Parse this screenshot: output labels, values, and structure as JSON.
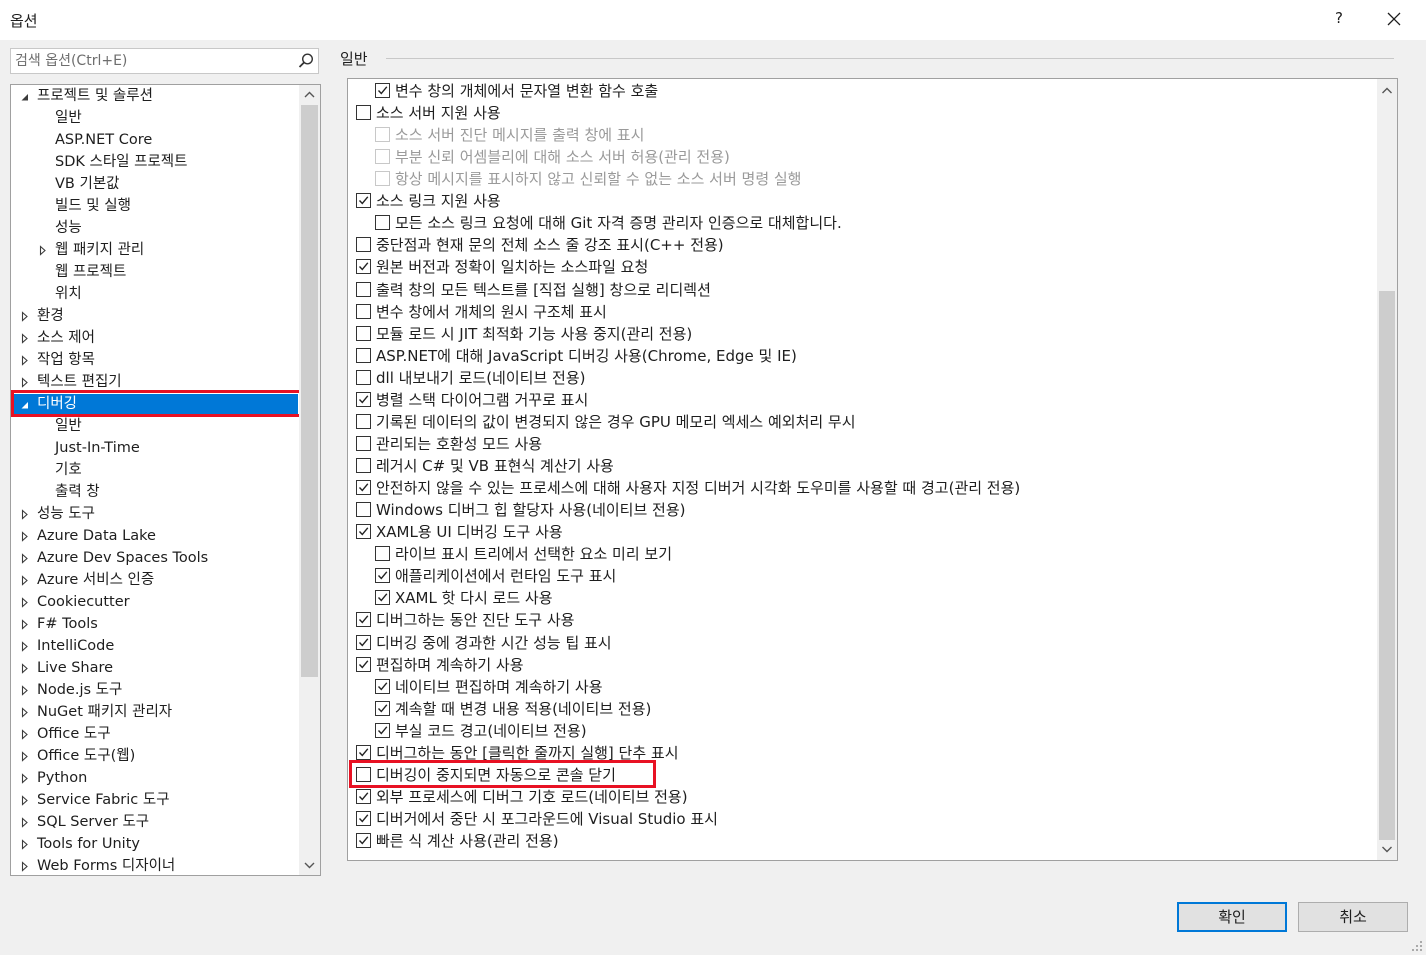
{
  "window": {
    "title": "옵션",
    "help_label": "?"
  },
  "search": {
    "placeholder": "검색 옵션(Ctrl+E)"
  },
  "tree": {
    "items": [
      {
        "label": "프로젝트 및 솔루션",
        "level": 0,
        "expander": "expanded"
      },
      {
        "label": "일반",
        "level": 1,
        "expander": "none"
      },
      {
        "label": "ASP.NET Core",
        "level": 1,
        "expander": "none"
      },
      {
        "label": "SDK 스타일 프로젝트",
        "level": 1,
        "expander": "none"
      },
      {
        "label": "VB 기본값",
        "level": 1,
        "expander": "none"
      },
      {
        "label": "빌드 및 실행",
        "level": 1,
        "expander": "none"
      },
      {
        "label": "성능",
        "level": 1,
        "expander": "none"
      },
      {
        "label": "웹 패키지 관리",
        "level": 1,
        "expander": "collapsed"
      },
      {
        "label": "웹 프로젝트",
        "level": 1,
        "expander": "none"
      },
      {
        "label": "위치",
        "level": 1,
        "expander": "none"
      },
      {
        "label": "환경",
        "level": 0,
        "expander": "collapsed"
      },
      {
        "label": "소스 제어",
        "level": 0,
        "expander": "collapsed"
      },
      {
        "label": "작업 항목",
        "level": 0,
        "expander": "collapsed"
      },
      {
        "label": "텍스트 편집기",
        "level": 0,
        "expander": "collapsed"
      },
      {
        "label": "디버깅",
        "level": 0,
        "expander": "expanded",
        "selected": true,
        "highlighted": true
      },
      {
        "label": "일반",
        "level": 1,
        "expander": "none"
      },
      {
        "label": "Just-In-Time",
        "level": 1,
        "expander": "none"
      },
      {
        "label": "기호",
        "level": 1,
        "expander": "none"
      },
      {
        "label": "출력 창",
        "level": 1,
        "expander": "none"
      },
      {
        "label": "성능 도구",
        "level": 0,
        "expander": "collapsed"
      },
      {
        "label": "Azure Data Lake",
        "level": 0,
        "expander": "collapsed"
      },
      {
        "label": "Azure Dev Spaces Tools",
        "level": 0,
        "expander": "collapsed"
      },
      {
        "label": "Azure 서비스 인증",
        "level": 0,
        "expander": "collapsed"
      },
      {
        "label": "Cookiecutter",
        "level": 0,
        "expander": "collapsed"
      },
      {
        "label": "F# Tools",
        "level": 0,
        "expander": "collapsed"
      },
      {
        "label": "IntelliCode",
        "level": 0,
        "expander": "collapsed"
      },
      {
        "label": "Live Share",
        "level": 0,
        "expander": "collapsed"
      },
      {
        "label": "Node.js 도구",
        "level": 0,
        "expander": "collapsed"
      },
      {
        "label": "NuGet 패키지 관리자",
        "level": 0,
        "expander": "collapsed"
      },
      {
        "label": "Office 도구",
        "level": 0,
        "expander": "collapsed"
      },
      {
        "label": "Office 도구(웹)",
        "level": 0,
        "expander": "collapsed"
      },
      {
        "label": "Python",
        "level": 0,
        "expander": "collapsed"
      },
      {
        "label": "Service Fabric 도구",
        "level": 0,
        "expander": "collapsed"
      },
      {
        "label": "SQL Server 도구",
        "level": 0,
        "expander": "collapsed"
      },
      {
        "label": "Tools for Unity",
        "level": 0,
        "expander": "collapsed"
      },
      {
        "label": "Web Forms 디자이너",
        "level": 0,
        "expander": "collapsed"
      }
    ]
  },
  "section": {
    "title": "일반"
  },
  "options": [
    {
      "label": "변수 창의 개체에서 문자열 변환 함수 호출",
      "level": 1,
      "checked": true
    },
    {
      "label": "소스 서버 지원 사용",
      "level": 0,
      "checked": false
    },
    {
      "label": "소스 서버 진단 메시지를 출력 창에 표시",
      "level": 1,
      "checked": false,
      "disabled": true
    },
    {
      "label": "부분 신뢰 어셈블리에 대해 소스 서버 허용(관리 전용)",
      "level": 1,
      "checked": false,
      "disabled": true
    },
    {
      "label": "항상 메시지를 표시하지 않고 신뢰할 수 없는 소스 서버 명령 실행",
      "level": 1,
      "checked": false,
      "disabled": true
    },
    {
      "label": "소스 링크 지원 사용",
      "level": 0,
      "checked": true
    },
    {
      "label": "모든 소스 링크 요청에 대해 Git 자격 증명 관리자 인증으로 대체합니다.",
      "level": 1,
      "checked": false
    },
    {
      "label": "중단점과 현재 문의 전체 소스 줄 강조 표시(C++ 전용)",
      "level": 0,
      "checked": false
    },
    {
      "label": "원본 버전과 정확이 일치하는 소스파일 요청",
      "level": 0,
      "checked": true
    },
    {
      "label": "출력 창의 모든 텍스트를 [직접 실행] 창으로 리디렉션",
      "level": 0,
      "checked": false
    },
    {
      "label": "변수 창에서 개체의 원시 구조체 표시",
      "level": 0,
      "checked": false
    },
    {
      "label": "모듈 로드 시 JIT 최적화 기능 사용 중지(관리 전용)",
      "level": 0,
      "checked": false
    },
    {
      "label": "ASP.NET에 대해 JavaScript 디버깅 사용(Chrome, Edge 및 IE)",
      "level": 0,
      "checked": false
    },
    {
      "label": "dll 내보내기 로드(네이티브 전용)",
      "level": 0,
      "checked": false
    },
    {
      "label": "병렬 스택 다이어그램 거꾸로 표시",
      "level": 0,
      "checked": true
    },
    {
      "label": "기록된 데이터의 값이 변경되지 않은 경우 GPU 메모리 엑세스 예외처리 무시",
      "level": 0,
      "checked": false
    },
    {
      "label": "관리되는 호환성 모드 사용",
      "level": 0,
      "checked": false
    },
    {
      "label": "레거시 C# 및 VB 표현식 계산기 사용",
      "level": 0,
      "checked": false
    },
    {
      "label": "안전하지 않을 수 있는 프로세스에 대해 사용자 지정 디버거 시각화 도우미를 사용할 때 경고(관리 전용)",
      "level": 0,
      "checked": true
    },
    {
      "label": "Windows 디버그 힙 할당자 사용(네이티브 전용)",
      "level": 0,
      "checked": false
    },
    {
      "label": "XAML용 UI 디버깅 도구 사용",
      "level": 0,
      "checked": true
    },
    {
      "label": "라이브 표시 트리에서 선택한 요소 미리 보기",
      "level": 1,
      "checked": false
    },
    {
      "label": "애플리케이션에서 런타임 도구 표시",
      "level": 1,
      "checked": true
    },
    {
      "label": "XAML 핫 다시 로드 사용",
      "level": 1,
      "checked": true
    },
    {
      "label": "디버그하는 동안 진단 도구 사용",
      "level": 0,
      "checked": true
    },
    {
      "label": "디버깅 중에 경과한 시간 성능 팁 표시",
      "level": 0,
      "checked": true
    },
    {
      "label": "편집하며 계속하기 사용",
      "level": 0,
      "checked": true
    },
    {
      "label": "네이티브 편집하며 계속하기 사용",
      "level": 1,
      "checked": true
    },
    {
      "label": "계속할 때 변경 내용 적용(네이티브 전용)",
      "level": 1,
      "checked": true
    },
    {
      "label": "부실 코드 경고(네이티브 전용)",
      "level": 1,
      "checked": true
    },
    {
      "label": "디버그하는 동안 [클릭한 줄까지 실행] 단추 표시",
      "level": 0,
      "checked": true
    },
    {
      "label": "디버깅이 중지되면 자동으로 콘솔 닫기",
      "level": 0,
      "checked": false,
      "highlighted": true
    },
    {
      "label": "외부 프로세스에 디버그 기호 로드(네이티브 전용)",
      "level": 0,
      "checked": true
    },
    {
      "label": "디버거에서 중단 시 포그라운드에 Visual Studio 표시",
      "level": 0,
      "checked": true
    },
    {
      "label": "빠른 식 계산 사용(관리 전용)",
      "level": 0,
      "checked": true
    }
  ],
  "buttons": {
    "ok_label": "확인",
    "cancel_label": "취소"
  },
  "colors": {
    "selection": "#0078d7",
    "highlight_box": "#e81123"
  }
}
